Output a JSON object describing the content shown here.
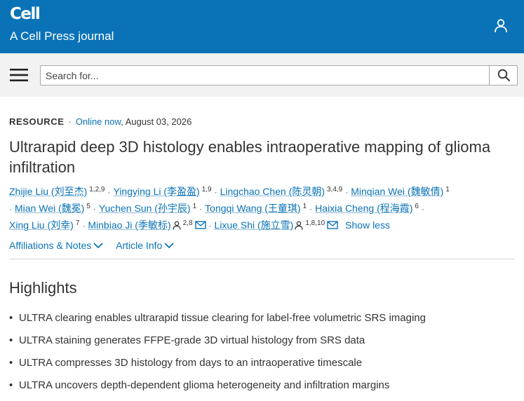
{
  "header": {
    "logo": "Cell",
    "journal": "A Cell Press journal",
    "bg_color": "#0a73b7"
  },
  "search": {
    "placeholder": "Search for..."
  },
  "article": {
    "type": "RESOURCE",
    "online_label": "Online now",
    "date": ", August 03, 2026",
    "title": "Ultrarapid deep 3D histology enables intraoperative mapping of glioma infiltration"
  },
  "authors": {
    "a1": {
      "name": "Zhijie Liu (刘至杰)",
      "sup": "1,2,9"
    },
    "a2": {
      "name": "Yingying Li (李盈盈)",
      "sup": "1,9"
    },
    "a3": {
      "name": "Lingchao Chen (陈灵朝)",
      "sup": "3,4,9"
    },
    "a4": {
      "name": "Minqian Wei (魏敏倩)",
      "sup": "1"
    },
    "a5": {
      "name": "Mian Wei (魏冕)",
      "sup": "5"
    },
    "a6": {
      "name": "Yuchen Sun (孙宇辰)",
      "sup": "1"
    },
    "a7": {
      "name": "Tongqi Wang (王童琪)",
      "sup": "1"
    },
    "a8": {
      "name": "Haixia Cheng (程海霞)",
      "sup": "6"
    },
    "a9": {
      "name": "Xing Liu (刘幸)",
      "sup": "7"
    },
    "a10": {
      "name": "Minbiao Ji (季敏标)",
      "sup": "2,8"
    },
    "a11": {
      "name": "Lixue Shi (施立雪)",
      "sup": "1,8,10"
    },
    "show_less": "Show less"
  },
  "tabs": {
    "affiliations": "Affiliations & Notes",
    "article_info": "Article Info"
  },
  "highlights": {
    "title": "Highlights",
    "items": [
      "ULTRA clearing enables ultrarapid tissue clearing for label-free volumetric SRS imaging",
      "ULTRA staining generates FFPE-grade 3D virtual histology from SRS data",
      "ULTRA compresses 3D histology from days to an intraoperative timescale",
      "ULTRA uncovers depth-dependent glioma heterogeneity and infiltration margins"
    ]
  },
  "icons": [
    "user-icon",
    "menu-icon",
    "search-icon",
    "person-icon",
    "envelope-icon",
    "chevron-down-icon"
  ]
}
